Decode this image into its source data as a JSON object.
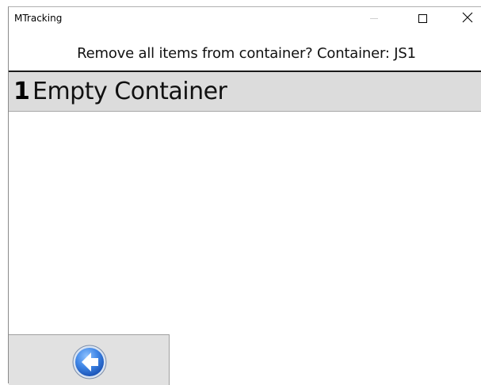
{
  "window": {
    "title": "MTracking",
    "controls": {
      "minimize_icon": "minimize-icon",
      "maximize_icon": "maximize-icon",
      "close_icon": "close-icon"
    }
  },
  "prompt": {
    "text": "Remove all items from container? Container: JS1"
  },
  "menu": {
    "items": [
      {
        "number": "1",
        "label": "Empty Container"
      }
    ]
  },
  "footer": {
    "back_icon": "back-arrow-icon"
  },
  "colors": {
    "menu_row_bg": "#dcdcdc",
    "back_button_bg": "#e1e1e1",
    "back_icon_blue": "#2f6fd1"
  }
}
